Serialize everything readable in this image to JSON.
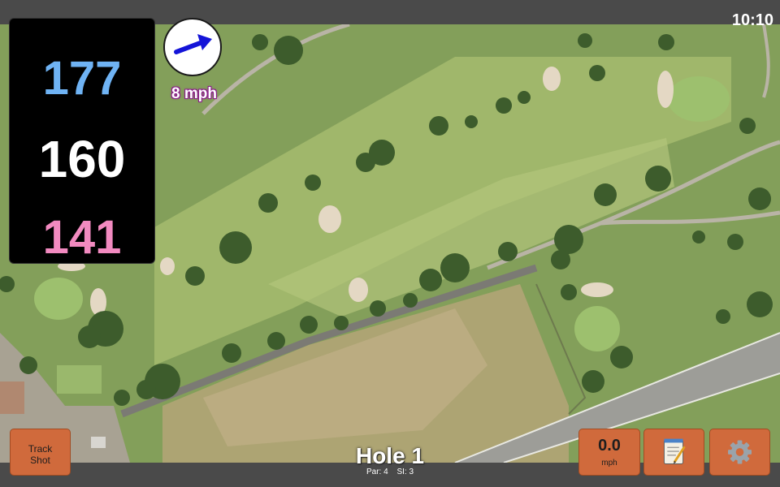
{
  "status": {
    "time": "10:10"
  },
  "distances": {
    "back": "177",
    "middle": "160",
    "front": "141"
  },
  "wind": {
    "speed": "8 mph",
    "arrow_icon": "wind-arrow-icon"
  },
  "buttons": {
    "track_shot": "Track Shot",
    "speed_value": "0.0",
    "speed_unit": "mph",
    "notes_icon": "notepad-icon",
    "settings_icon": "gear-icon"
  },
  "hole": {
    "title": "Hole 1",
    "par": "Par: 4",
    "si": "SI: 3"
  },
  "colors": {
    "back_distance": "#6fb3f4",
    "middle_distance": "#ffffff",
    "front_distance": "#f28ac0",
    "button_orange": "#d06a3c",
    "wind_label_outline": "#8a1a8a"
  }
}
